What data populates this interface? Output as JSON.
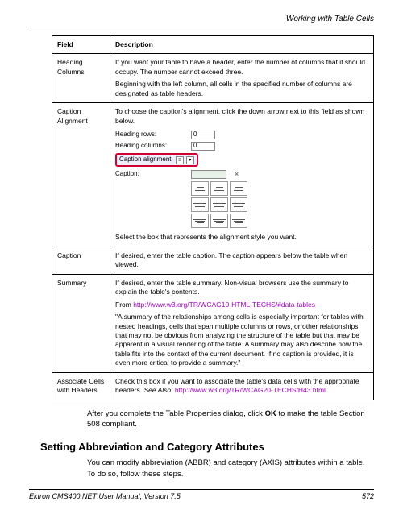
{
  "header": {
    "title": "Working with Table Cells"
  },
  "table": {
    "col_field": "Field",
    "col_desc": "Description",
    "rows": {
      "heading_columns": {
        "field": "Heading Columns",
        "p1": "If you want your table to have a header, enter the number of columns that it should occupy. The number cannot exceed three.",
        "p2": "Beginning with the left column, all cells in the specified number of columns are designated as table headers."
      },
      "caption_alignment": {
        "field": "Caption Alignment",
        "p1": "To choose the caption's alignment, click the down arrow next to this field as shown below.",
        "mini": {
          "heading_rows_label": "Heading rows:",
          "heading_rows_val": "0",
          "heading_cols_label": "Heading columns:",
          "heading_cols_val": "0",
          "caption_align_label": "Caption alignment:",
          "caption_label": "Caption:"
        },
        "p2": "Select the box that represents the alignment style you want."
      },
      "caption": {
        "field": "Caption",
        "p1": "If desired, enter the table caption. The caption appears below the table when viewed."
      },
      "summary": {
        "field": "Summary",
        "p1": "If desired, enter the table summary. Non-visual browsers use the summary to explain the table's contents.",
        "from": "From ",
        "link": "http://www.w3.org/TR/WCAG10-HTML-TECHS/#data-tables",
        "quote": "\"A summary of the relationships among cells is especially important for tables with nested headings, cells that span multiple columns or rows, or other relationships that may not be obvious from analyzing the structure of the table but that may be apparent in a visual rendering of the table. A summary may also describe how the table fits into the context of the current document. If no caption is provided, it is even more critical to provide a summary.\""
      },
      "associate": {
        "field": "Associate Cells with Headers",
        "p1a": "Check this box if you want to associate the table's data cells with the appropriate headers. ",
        "see_also_label": "See Also: ",
        "link": "http://www.w3.org/TR/WCAG20-TECHS/H43.html"
      }
    }
  },
  "after_table": {
    "p1a": "After you complete the Table Properties dialog, click ",
    "ok": "OK",
    "p1b": " to make the table Section 508 compliant."
  },
  "section_heading": "Setting Abbreviation and Category Attributes",
  "body_para": "You can modify abbreviation (ABBR) and category (AXIS) attributes within a table. To do so, follow these steps.",
  "footer": {
    "left": "Ektron CMS400.NET User Manual, Version 7.5",
    "right": "572"
  }
}
